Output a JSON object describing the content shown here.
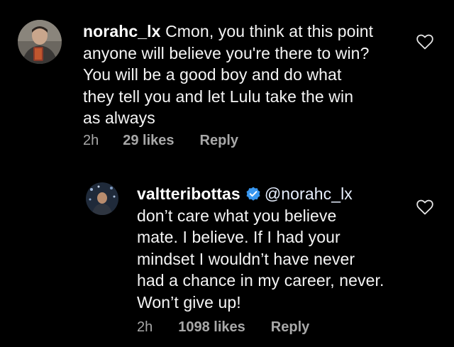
{
  "comments": [
    {
      "username": "norahc_lx",
      "text_lines": [
        "Cmon, you think at this point",
        "anyone will believe you're there to win?",
        "You will be a good boy and do what",
        "they tell you and let Lulu take the win",
        "as always"
      ],
      "time": "2h",
      "likes": "29 likes",
      "reply_label": "Reply",
      "heart_icon": "heart-outline-icon"
    },
    {
      "username": "valtteribottas",
      "verified": true,
      "mention": "@norahc_lx",
      "text_lines": [
        "don’t care what you believe",
        "mate. I believe. If I had your",
        "mindset I wouldn’t have never",
        "had a chance in my career, never.",
        "Won’t give up!"
      ],
      "time": "2h",
      "likes": "1098 likes",
      "reply_label": "Reply",
      "heart_icon": "heart-outline-icon"
    }
  ],
  "colors": {
    "background": "#000000",
    "text": "#f5f5f5",
    "meta": "#a8a8a8",
    "verified_badge": "#3897f0"
  }
}
